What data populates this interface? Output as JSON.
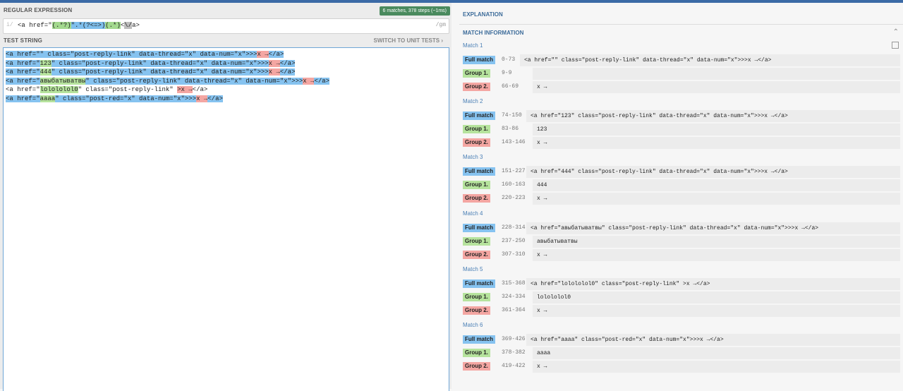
{
  "regex_section": {
    "title": "REGULAR EXPRESSION",
    "badge": "6 matches, 378 steps (~1ms)",
    "slash": "i/",
    "pattern_parts": [
      "<a href=\"",
      "(.*?)",
      "\"",
      ".*(?<=>)",
      "(.*)",
      "<",
      "\\/",
      "a>"
    ],
    "flags": "/gm"
  },
  "test_section": {
    "title": "TEST STRING",
    "switch_label": "SWITCH TO UNIT TESTS ›",
    "lines": [
      [
        "<a href=\"",
        "\" class=\"post-reply-link\" data-thread=\"x\" data-num=\"x\">>>",
        "x →",
        "</a>"
      ],
      [
        "<a href=\"",
        "123",
        "\" class=\"post-reply-link\" data-thread=\"x\" data-num=\"x\">>>",
        "x →",
        "</a>"
      ],
      [
        "<a href=\"",
        "444",
        "\" class=\"post-reply-link\" data-thread=\"x\" data-num=\"x\">>>",
        "x →",
        "</a>"
      ],
      [
        "<a href=\"",
        "авыбатыватвы",
        "\" class=\"post-reply-link\" data-thread=\"x\" data-num=\"x\">>>",
        "x →",
        "</a>"
      ],
      [
        "<a href=\"",
        "lolololol0",
        "\" class=\"post-reply-link\" ",
        ">x →",
        "</a>"
      ],
      [
        "<a href=\"",
        "aaaa",
        "\" class=\"post-red=\"x\" data-num=\"x\">>>",
        "x →",
        "</a>"
      ]
    ]
  },
  "explanation": {
    "title": "EXPLANATION"
  },
  "match_info": {
    "title": "MATCH INFORMATION",
    "labels": {
      "full": "Full match",
      "g1": "Group 1.",
      "g2": "Group 2."
    },
    "matches": [
      {
        "title": "Match 1",
        "full_range": "0-73",
        "full": "<a href=\"\" class=\"post-reply-link\" data-thread=\"x\" data-num=\"x\">>>x →</a>",
        "g1_range": "9-9",
        "g1": "",
        "g2_range": "66-69",
        "g2": "x →"
      },
      {
        "title": "Match 2",
        "full_range": "74-150",
        "full": "<a href=\"123\" class=\"post-reply-link\" data-thread=\"x\" data-num=\"x\">>>x →</a>",
        "g1_range": "83-86",
        "g1": "123",
        "g2_range": "143-146",
        "g2": "x →"
      },
      {
        "title": "Match 3",
        "full_range": "151-227",
        "full": "<a href=\"444\" class=\"post-reply-link\" data-thread=\"x\" data-num=\"x\">>>x →</a>",
        "g1_range": "160-163",
        "g1": "444",
        "g2_range": "220-223",
        "g2": "x →"
      },
      {
        "title": "Match 4",
        "full_range": "228-314",
        "full": "<a href=\"авыбатыватвы\" class=\"post-reply-link\" data-thread=\"x\" data-num=\"x\">>>x →</a>",
        "g1_range": "237-250",
        "g1": "авыбатыватвы",
        "g2_range": "307-310",
        "g2": "x →"
      },
      {
        "title": "Match 5",
        "full_range": "315-368",
        "full": "<a href=\"lolololol0\" class=\"post-reply-link\" >x →</a>",
        "g1_range": "324-334",
        "g1": "lolololol0",
        "g2_range": "361-364",
        "g2": "x →"
      },
      {
        "title": "Match 6",
        "full_range": "369-426",
        "full": "<a href=\"aaaa\" class=\"post-red=\"x\" data-num=\"x\">>>x →</a>",
        "g1_range": "378-382",
        "g1": "aaaa",
        "g2_range": "419-422",
        "g2": "x →"
      }
    ]
  },
  "colors": {
    "accent": "#3b6aa6",
    "full": "#86c3f0",
    "group1": "#b6e39d",
    "group2": "#f4a6a2",
    "badge": "#4a8a5e"
  }
}
